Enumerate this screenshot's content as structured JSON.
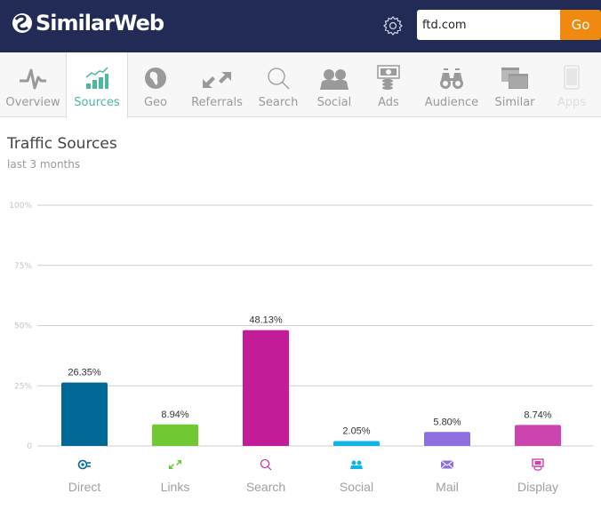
{
  "header": {
    "brand": "SimilarWeb",
    "settings_icon": "gear-icon",
    "search": {
      "value": "ftd.com",
      "placeholder": ""
    },
    "go_label": "Go",
    "colors": {
      "bar_bg": "#222b55",
      "go_bg": "#f0890f"
    }
  },
  "nav": {
    "items": [
      {
        "label": "Overview",
        "icon": "pulse-icon",
        "state": "normal"
      },
      {
        "label": "Sources",
        "icon": "bar-growth-icon",
        "state": "active"
      },
      {
        "label": "Geo",
        "icon": "globe-icon",
        "state": "normal"
      },
      {
        "label": "Referrals",
        "icon": "arrows-icon",
        "state": "normal"
      },
      {
        "label": "Search",
        "icon": "magnifier-icon",
        "state": "normal"
      },
      {
        "label": "Social",
        "icon": "people-icon",
        "state": "normal"
      },
      {
        "label": "Ads",
        "icon": "money-icon",
        "state": "normal"
      },
      {
        "label": "Audience",
        "icon": "binoculars-icon",
        "state": "normal"
      },
      {
        "label": "Similar",
        "icon": "windows-icon",
        "state": "normal"
      },
      {
        "label": "Apps",
        "icon": "phone-icon",
        "state": "disabled"
      }
    ],
    "active_color": "#4cb8a0"
  },
  "section": {
    "title": "Traffic Sources",
    "subtitle": "last 3 months"
  },
  "chart_data": {
    "type": "bar",
    "title": "Traffic Sources",
    "subtitle": "last 3 months",
    "xlabel": "",
    "ylabel": "",
    "ylim": [
      0,
      100
    ],
    "yticks": [
      0,
      25,
      50,
      75,
      100
    ],
    "ytick_labels": [
      "0",
      "25%",
      "50%",
      "75%",
      "100%"
    ],
    "grid": true,
    "legend": "none",
    "categories": [
      "Direct",
      "Links",
      "Search",
      "Social",
      "Mail",
      "Display"
    ],
    "values": [
      26.35,
      8.94,
      48.13,
      2.05,
      5.8,
      8.74
    ],
    "value_labels": [
      "26.35%",
      "8.94%",
      "48.13%",
      "2.05%",
      "5.80%",
      "8.74%"
    ],
    "colors": [
      "#016796",
      "#70c933",
      "#c21c98",
      "#11b4e6",
      "#8e6fe0",
      "#cc44ae"
    ],
    "icons": [
      "direct-icon",
      "links-icon",
      "search-icon",
      "social-icon",
      "mail-icon",
      "display-icon"
    ]
  }
}
